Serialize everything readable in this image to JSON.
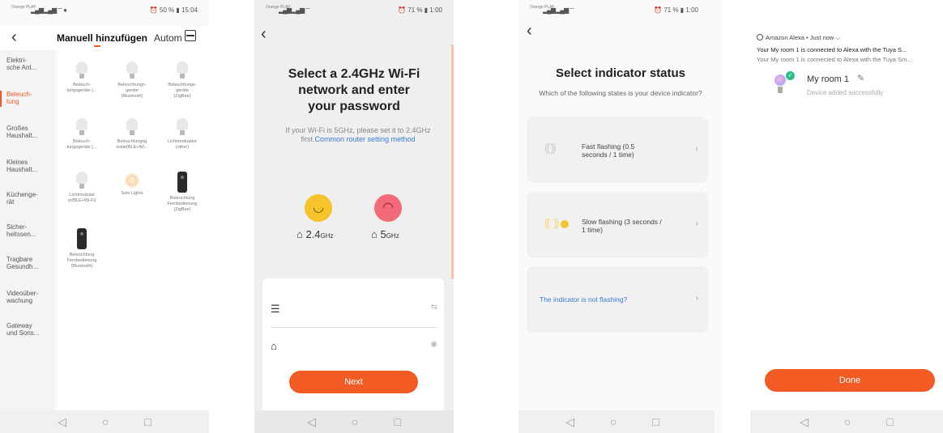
{
  "phone1": {
    "status": {
      "carrier": "Orange PLAY",
      "signal": "▂▄▆ ▂▄▆ ⌔ ●",
      "right": "⏰ 50 % ▮ 15:04"
    },
    "title": "Manuell hinzufügen",
    "auto_tab": "Autom",
    "categories": [
      {
        "label": "Elektri-\nsche Anl..."
      },
      {
        "label": "Beleuch-\ntung"
      },
      {
        "label": "Großes\nHaushalt..."
      },
      {
        "label": "Kleines\nHaushalt..."
      },
      {
        "label": "Küchenge-\nrät"
      },
      {
        "label": "Sicher-\nheitssen..."
      },
      {
        "label": "Tragbare\nGesundh..."
      },
      {
        "label": "Videoüber-\nwachung"
      },
      {
        "label": "Gateway\nund Sons..."
      }
    ],
    "devices": [
      {
        "label": "Beleuch-\ntungsgeräte (...",
        "icon": "bulb"
      },
      {
        "label": "Beleuchtungs-\ngeräte\n(Bluetooth)",
        "icon": "bulb"
      },
      {
        "label": "Beleuchtungs-\ngeräte\n(ZigBee)",
        "icon": "bulb"
      },
      {
        "label": "Beleuch-\ntungsgeräte (...",
        "icon": "bulb"
      },
      {
        "label": "Beleuchtungsg\neräte(BLE+Wi...",
        "icon": "bulb"
      },
      {
        "label": "Lichtmodulator\n(other)",
        "icon": "bulb"
      },
      {
        "label": "Lichtmodulat\nor(BLE+Wi-Fi)",
        "icon": "bulb"
      },
      {
        "label": "Solo Lights",
        "icon": "solar"
      },
      {
        "label": "Beleuchtung\nFernbedienung\n(ZigBee)",
        "icon": "remote"
      },
      {
        "label": "Beleuchtung\nFernbedienung\n(Bluetooth)",
        "icon": "remote"
      }
    ]
  },
  "phone2": {
    "status": {
      "carrier": "Orange PLAY",
      "signal": "▂▄▆ ▂▄▆ ⌔",
      "right": "⏰ 71 % ▮ 1:00"
    },
    "heading": "Select a 2.4GHz Wi-Fi\nnetwork and enter\nyour password",
    "note_text": "If your Wi-Fi is 5GHz, please set it to 2.4GHz first.",
    "note_link": "Common router setting method",
    "band_ok": "2.4",
    "band_ok_unit": "GHz",
    "band_bad": "5",
    "band_bad_unit": "GHz",
    "next_label": "Next"
  },
  "phone3": {
    "status": {
      "carrier": "Orange PLAY",
      "signal": "▂▄▆ ▂▄▆ ⌔",
      "right": "⏰ 71 % ▮ 1:00"
    },
    "heading": "Select indicator status",
    "subtitle": "Which of the following states is your device indicator?",
    "options": [
      {
        "label": "Fast flashing (0.5\nseconds / 1 time)"
      },
      {
        "label": "Slow flashing (3 seconds /\n1 time)"
      }
    ],
    "not_flashing": "The indicator is not flashing?"
  },
  "phone4": {
    "notification": {
      "app": "Amazon Alexa • Just now",
      "title": "Your My room 1 is connected to Alexa with the Tuya S...",
      "body": "Your My room 1 is connected to Alexa with the Tuya Sm..."
    },
    "device_name": "My room 1",
    "device_status": "Device added successfully",
    "done_label": "Done"
  },
  "colors": {
    "accent": "#f25b24",
    "link": "#3a7bd5",
    "success": "#2bbf8a"
  }
}
